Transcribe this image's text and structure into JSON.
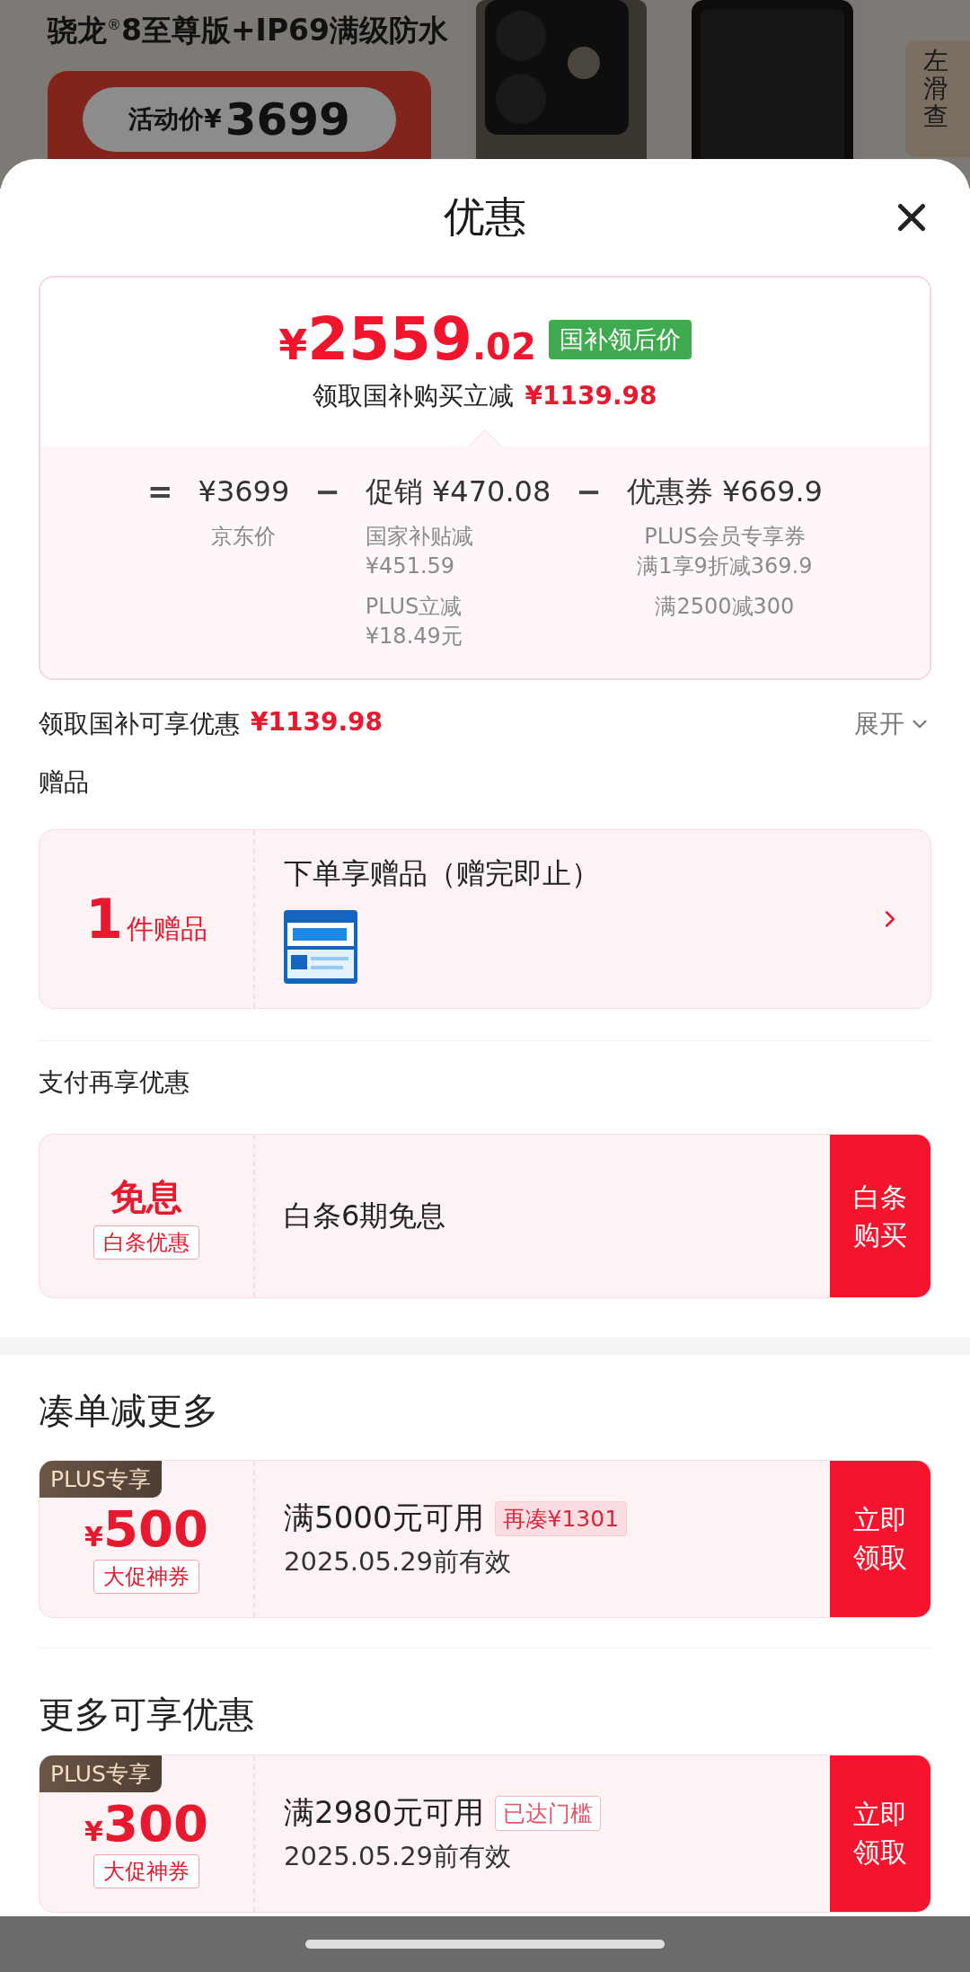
{
  "background_page": {
    "headline": "骁龙$^{®}$8至尊版+IP69满级防水",
    "price_label": "活动价¥",
    "price": "3699",
    "side_tab": "左滑查"
  },
  "sheet": {
    "title": "优惠"
  },
  "price_card": {
    "currency": "¥",
    "price_int": "2559",
    "price_dec": ".02",
    "tag": "国补领后价",
    "saving_label": "领取国补购买立减",
    "saving_amount": "¥1139.98",
    "breakdown": [
      {
        "operator": "=",
        "amount": "¥3699",
        "notes": [
          [
            "京东价"
          ]
        ]
      },
      {
        "operator": "−",
        "title": "促销",
        "amount": "¥470.08",
        "notes": [
          [
            "国家补贴减",
            "¥451.59"
          ],
          [
            "PLUS立减",
            "¥18.49元"
          ]
        ]
      },
      {
        "operator": "−",
        "title": "优惠券",
        "amount": "¥669.9",
        "notes": [
          [
            "PLUS会员专享券",
            "满1享9折减369.9"
          ],
          [
            "满2500减300"
          ]
        ]
      }
    ]
  },
  "summary": {
    "label": "领取国补可享优惠",
    "amount": "¥1139.98",
    "toggle": "展开",
    "expanded": false
  },
  "gifts": {
    "heading": "赠品",
    "count": "1",
    "count_unit": "件赠品",
    "title": "下单享赠品（赠完即止）"
  },
  "payment": {
    "heading": "支付再享优惠",
    "main": "免息",
    "tag": "白条优惠",
    "title": "白条6期免息",
    "action": "白条购买"
  },
  "coupon_sections": [
    {
      "heading": "凑单减更多",
      "coupons": [
        {
          "badge": "PLUS专享",
          "currency": "¥",
          "amount": "500",
          "type": "大促神券",
          "condition": "满5000元可用",
          "tag": "再凑¥1301",
          "kind": "filled",
          "validity": "2025.05.29前有效",
          "action": "立即领取"
        }
      ]
    },
    {
      "heading": "更多可享优惠",
      "coupons": [
        {
          "badge": "PLUS专享",
          "currency": "¥",
          "amount": "300",
          "type": "大促神券",
          "condition": "满2980元可用",
          "tag": "已达门槛",
          "kind": "outline",
          "validity": "2025.05.29前有效",
          "action": "立即领取"
        }
      ]
    }
  ]
}
